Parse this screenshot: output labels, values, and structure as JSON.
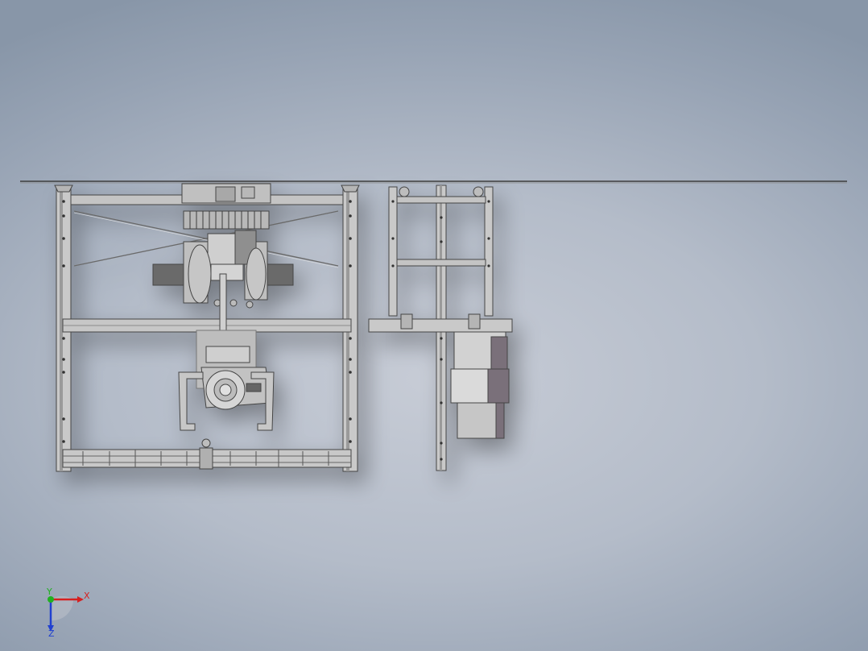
{
  "view": {
    "background_top": "#8a98aa",
    "background_center": "#c6cbd5"
  },
  "model": {
    "frame_color": "#4a4a4a",
    "fill_color": "#c8c8c8",
    "dark_fill": "#6e6e6e",
    "purple_fill": "#7a6f7a",
    "light_panel": "#d8d8d8"
  },
  "triad": {
    "x_label": "X",
    "y_label": "Y",
    "z_label": "Z",
    "x_color": "#d62020",
    "y_color": "#21b021",
    "z_color": "#2040d0"
  }
}
